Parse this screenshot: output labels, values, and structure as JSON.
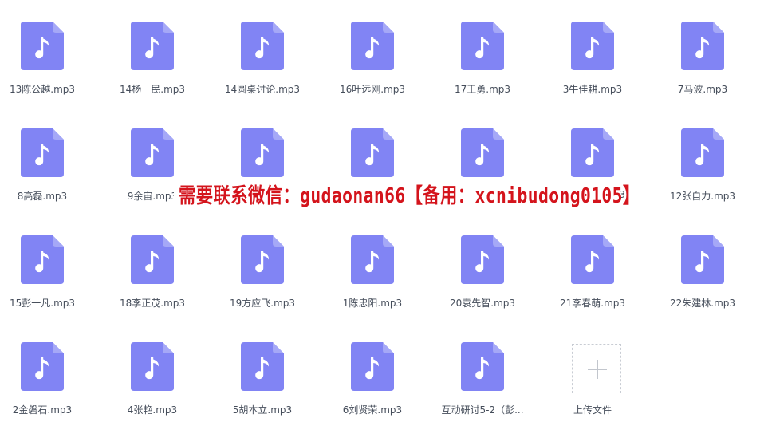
{
  "files": [
    {
      "name": "13陈公越.mp3"
    },
    {
      "name": "14杨一民.mp3"
    },
    {
      "name": "14圆桌讨论.mp3"
    },
    {
      "name": "16叶远刚.mp3"
    },
    {
      "name": "17王勇.mp3"
    },
    {
      "name": "3牛佳耕.mp3"
    },
    {
      "name": "7马波.mp3"
    },
    {
      "name": "8高磊.mp3"
    },
    {
      "name": "9余宙.mp3"
    },
    {
      "name": ""
    },
    {
      "name": ""
    },
    {
      "name": ""
    },
    {
      "name": "3"
    },
    {
      "name": "12张自力.mp3"
    },
    {
      "name": "15彭一凡.mp3"
    },
    {
      "name": "18李正茂.mp3"
    },
    {
      "name": "19方应飞.mp3"
    },
    {
      "name": "1陈忠阳.mp3"
    },
    {
      "name": "20袁先智.mp3"
    },
    {
      "name": "21李春萌.mp3"
    },
    {
      "name": "22朱建林.mp3"
    },
    {
      "name": "2金磐石.mp3"
    },
    {
      "name": "4张艳.mp3"
    },
    {
      "name": "5胡本立.mp3"
    },
    {
      "name": "6刘贤荣.mp3"
    },
    {
      "name": "互动研讨5-2（彭..."
    }
  ],
  "upload": {
    "label": "上传文件"
  },
  "watermark": {
    "text": "需要联系微信：gudaonan66【备用：xcnibudong0105】"
  },
  "colors": {
    "icon_fill": "#8184f4",
    "icon_fold": "#a5a8f7",
    "label": "#454d5a",
    "watermark": "#d4141c"
  }
}
